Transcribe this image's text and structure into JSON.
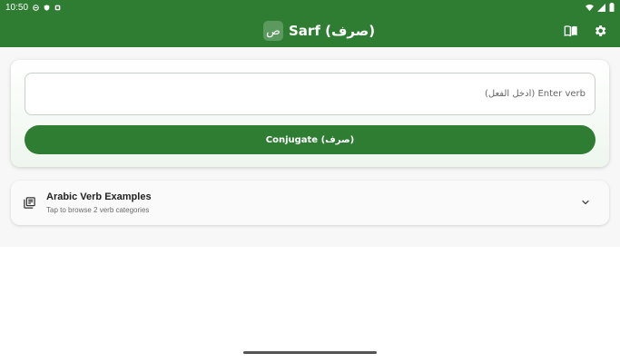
{
  "status_bar": {
    "time": "10:50"
  },
  "app_bar": {
    "logo_char": "ص",
    "title": "Sarf (صرف)"
  },
  "verb_input": {
    "placeholder": "Enter verb (أدخل الفعل)",
    "value": ""
  },
  "conjugate_button": {
    "label": "Conjugate (صرف)"
  },
  "examples_card": {
    "title": "Arabic Verb Examples",
    "subtitle": "Tap to browse 2 verb categories"
  },
  "colors": {
    "primary": "#2e7d32",
    "background": "#f6f7f6"
  }
}
